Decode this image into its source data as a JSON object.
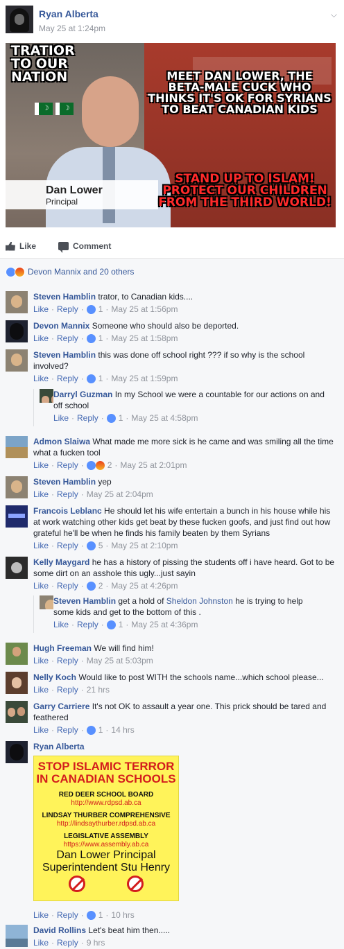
{
  "post": {
    "author": "Ryan Alberta",
    "time": "May 25 at 1:24pm",
    "menu_icon": "chevron-down-icon",
    "image": {
      "text_top_left": "TRATIOR TO OUR NATION",
      "text_top_right": "MEET DAN LOWER, THE BETA-MALE CUCK WHO THINKS IT'S OK FOR SYRIANS TO BEAT CANADIAN KIDS",
      "text_bottom_right": "STAND UP TO ISLAM! PROTECT OUR CHILDREN FROM THE THIRD WORLD!",
      "lower_third_name": "Dan Lower",
      "lower_third_title": "Principal"
    },
    "actions": {
      "like": "Like",
      "comment": "Comment"
    },
    "reactions_summary": "Devon Mannix and 20 others"
  },
  "comments": [
    {
      "name": "Steven Hamblin",
      "text": "trator, to Canadian kids....",
      "like": "Like",
      "reply": "Reply",
      "reactions": "1",
      "time": "May 25 at 1:56pm"
    },
    {
      "name": "Devon Mannix",
      "text": "Someone who should also be deported.",
      "like": "Like",
      "reply": "Reply",
      "reactions": "1",
      "time": "May 25 at 1:58pm"
    },
    {
      "name": "Steven Hamblin",
      "text": "this was done off school right ??? if so why is the school involved?",
      "like": "Like",
      "reply": "Reply",
      "reactions": "1",
      "time": "May 25 at 1:59pm"
    },
    {
      "name": "Darryl Guzman",
      "text": "In my School we were a countable for our actions on and off school",
      "like": "Like",
      "reply": "Reply",
      "reactions": "1",
      "time": "May 25 at 4:58pm"
    },
    {
      "name": "Admon Slaiwa",
      "text": "What made me more sick is he came and was smiling all the time what a fucken tool",
      "like": "Like",
      "reply": "Reply",
      "reactions": "2",
      "time": "May 25 at 2:01pm"
    },
    {
      "name": "Steven Hamblin",
      "text": "yep",
      "like": "Like",
      "reply": "Reply",
      "time": "May 25 at 2:04pm"
    },
    {
      "name": "Francois Leblanc",
      "text": "He should let his wife entertain a bunch in his house while his at work watching other kids get beat by these fucken goofs, and just find out how grateful he'll be when he finds his family beaten by them Syrians",
      "like": "Like",
      "reply": "Reply",
      "reactions": "5",
      "time": "May 25 at 2:10pm"
    },
    {
      "name": "Kelly Maygard",
      "text": "he has a history of pissing the students off i have heard. Got to be some dirt on an asshole this ugly...just sayin",
      "like": "Like",
      "reply": "Reply",
      "reactions": "2",
      "time": "May 25 at 4:26pm"
    },
    {
      "name": "Steven Hamblin",
      "text_before": "get a hold of",
      "mention": "Sheldon Johnston",
      "text_after": "he is trying to help some kids and get to the bottom of this .",
      "like": "Like",
      "reply": "Reply",
      "reactions": "1",
      "time": "May 25 at 4:36pm"
    },
    {
      "name": "Hugh Freeman",
      "text": "We will find him!",
      "like": "Like",
      "reply": "Reply",
      "time": "May 25 at 5:03pm"
    },
    {
      "name": "Nelly Koch",
      "text": "Would like to post WITH the schools name...which school please...",
      "like": "Like",
      "reply": "Reply",
      "time": "21 hrs"
    },
    {
      "name": "Garry Carriere",
      "text": "It's not OK to assault a year one. This prick should be tared and feathered",
      "like": "Like",
      "reply": "Reply",
      "reactions": "1",
      "time": "14 hrs"
    },
    {
      "name": "Ryan Alberta",
      "like": "Like",
      "reply": "Reply",
      "reactions": "1",
      "time": "10 hrs"
    },
    {
      "name": "David Rollins",
      "text": "Let's beat him then.....",
      "like": "Like",
      "reply": "Reply",
      "time": "9 hrs"
    }
  ],
  "poster": {
    "title": "STOP ISLAMIC TERROR IN CANADIAN SCHOOLS",
    "line1": "RED DEER SCHOOL BOARD",
    "url1": "http://www.rdpsd.ab.ca",
    "line2": "LINDSAY THURBER COMPREHENSIVE",
    "url2": "http://lindsaythurber.rdpsd.ab.ca",
    "line3": "LEGISLATIVE ASSEMBLY",
    "url3": "https://www.assembly.ab.ca",
    "big1": "Dan Lower Principal",
    "big2": "Superintendent Stu Henry",
    "icon_left": "no-islam-icon",
    "icon_right": "no-sharia-icon"
  },
  "colors": {
    "link": "#365899",
    "meta": "#90949c",
    "like_blue": "#5890ff",
    "poster_yellow": "#fff35a",
    "poster_red": "#d31d1d"
  }
}
